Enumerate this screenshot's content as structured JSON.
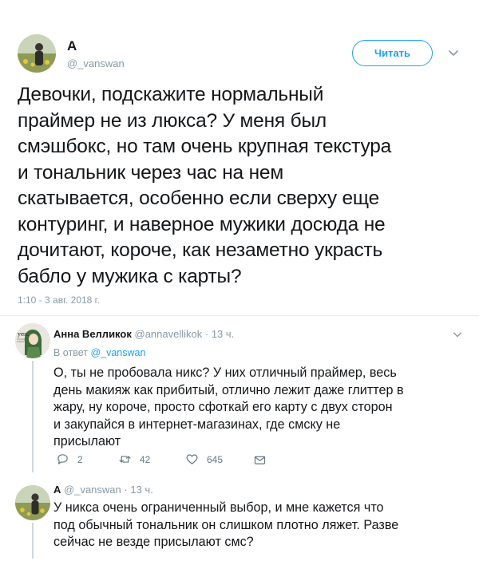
{
  "main_tweet": {
    "author_name": "A",
    "handle": "@_vanswan",
    "follow_label": "Читать",
    "text": "Девочки, подскажите нормальный\nпраймер не из люкса? У меня был\nсмэшбокс,  но там очень крупная текстура\nи тональник через час на нем\nскатывается,  особенно если сверху еще\nконтуринг, и наверное мужики досюда не\nдочитают, короче, как незаметно украсть\nбабло у мужика с карты?",
    "timestamp": "1:10 - 3 авг. 2018 г."
  },
  "reply_1": {
    "author_name": "Анна Велликок",
    "handle": "@annavellikok",
    "separator": "·",
    "time": "13 ч.",
    "replying_prefix": "В ответ",
    "replying_handle": "@_vanswan",
    "avatar_text": "yes.",
    "text": "О, ты не пробовала никс? У них отличный праймер, весь\nдень макияж как прибитый, отлично лежит даже глиттер в\nжару, ну короче, просто сфоткай его карту с двух сторон\nи закупайся в интернет-магазинах, где смску не\nприсылают",
    "actions": {
      "reply_count": "2",
      "retweet_count": "42",
      "like_count": "645"
    }
  },
  "reply_2": {
    "author_name": "A",
    "handle": "@_vanswan",
    "separator": "·",
    "time": "13 ч.",
    "text": "У никса очень ограниченный выбор, и мне кажется что\nпод обычный тональник он слишком плотно ляжет. Разве\nсейчас не везде присылают смс?"
  },
  "colors": {
    "accent": "#1da1f2",
    "secondary_text": "#8899a6",
    "primary_text": "#14171a",
    "divider": "#e6ecf0"
  }
}
